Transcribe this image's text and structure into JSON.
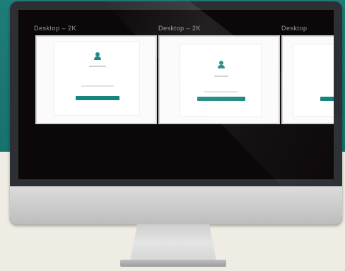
{
  "screen": {
    "devices": [
      {
        "label": "Desktop – 2K"
      },
      {
        "label": "Desktop – 2K"
      },
      {
        "label": "Desktop"
      }
    ]
  },
  "colors": {
    "accent": "#17857f",
    "background_top": "#1f7d78",
    "background_bottom": "#efece3",
    "screen_bg": "#0c0708"
  },
  "icons": [
    "user-avatar-icon"
  ]
}
